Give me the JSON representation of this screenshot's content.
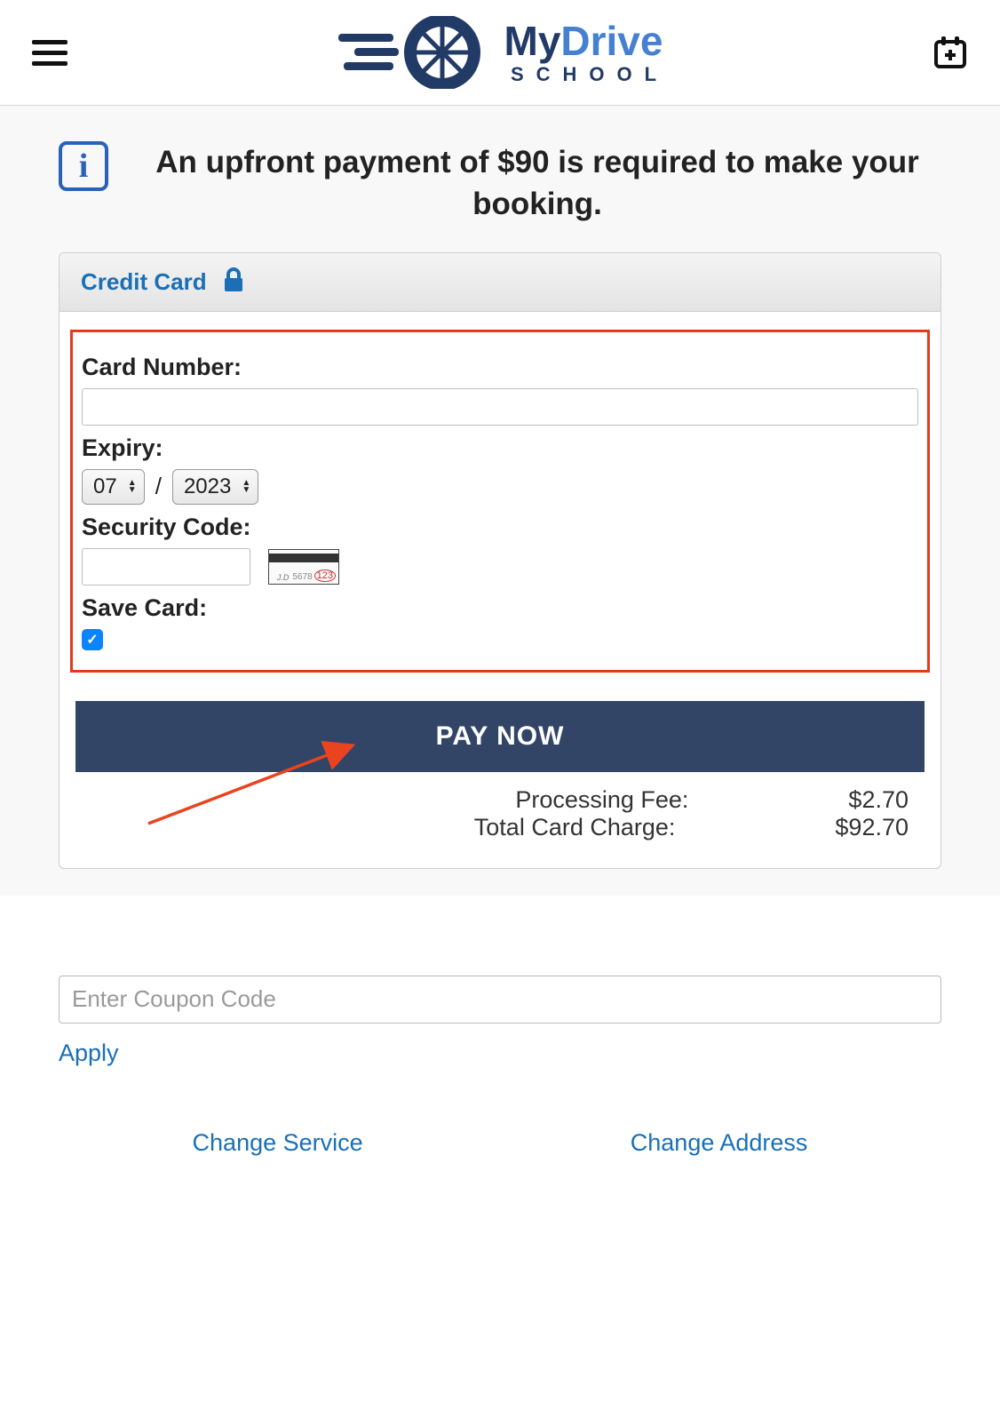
{
  "header": {
    "brand_my": "My",
    "brand_drive": "Drive",
    "brand_school": "SCHOOL"
  },
  "notice": {
    "text": "An upfront payment of $90 is required to make your booking."
  },
  "payment_card": {
    "header_title": "Credit Card",
    "card_number_label": "Card Number:",
    "card_number_value": "",
    "expiry_label": "Expiry:",
    "expiry_month": "07",
    "expiry_year": "2023",
    "expiry_separator": "/",
    "security_code_label": "Security Code:",
    "security_code_value": "",
    "cvc_hint_digits": "123",
    "save_card_label": "Save Card:",
    "save_card_checked": true,
    "pay_button_label": "PAY NOW",
    "processing_fee_label": "Processing Fee:",
    "processing_fee_value": "$2.70",
    "total_charge_label": "Total Card Charge:",
    "total_charge_value": "$92.70"
  },
  "coupon": {
    "placeholder": "Enter Coupon Code",
    "apply_label": "Apply"
  },
  "footer_links": {
    "change_service": "Change Service",
    "change_address": "Change Address"
  }
}
